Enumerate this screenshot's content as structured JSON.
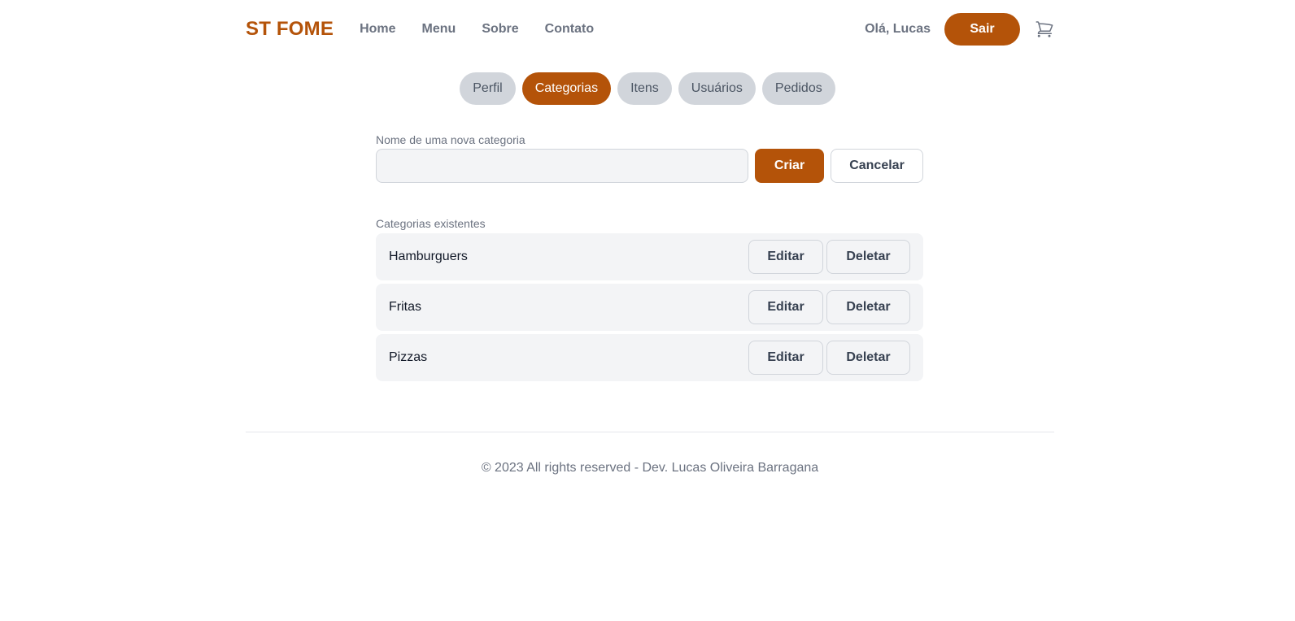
{
  "header": {
    "logo": "ST FOME",
    "nav": [
      "Home",
      "Menu",
      "Sobre",
      "Contato"
    ],
    "greeting": "Olá, Lucas",
    "logout_label": "Sair",
    "cart_icon": "cart-icon"
  },
  "tabs": [
    {
      "label": "Perfil",
      "active": false
    },
    {
      "label": "Categorias",
      "active": true
    },
    {
      "label": "Itens",
      "active": false
    },
    {
      "label": "Usuários",
      "active": false
    },
    {
      "label": "Pedidos",
      "active": false
    }
  ],
  "form": {
    "label": "Nome de uma nova categoria",
    "value": "",
    "placeholder": "",
    "create_label": "Criar",
    "cancel_label": "Cancelar"
  },
  "categories": {
    "label": "Categorias existentes",
    "edit_label": "Editar",
    "delete_label": "Deletar",
    "items": [
      "Hamburguers",
      "Fritas",
      "Pizzas"
    ]
  },
  "footer": {
    "text": "© 2023 All rights reserved - Dev. Lucas Oliveira Barragana"
  },
  "colors": {
    "accent": "#b45309",
    "tab_inactive": "#d1d5db",
    "row_bg": "#f3f4f6"
  }
}
